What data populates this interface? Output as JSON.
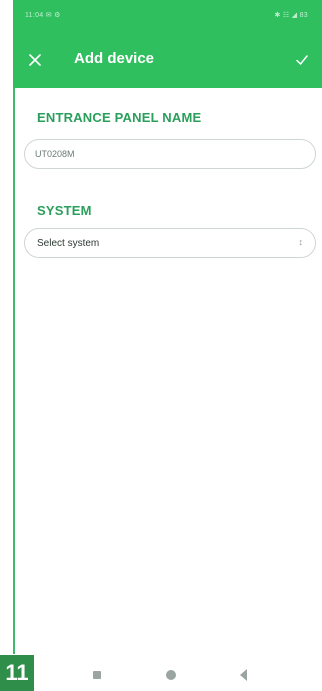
{
  "status_bar": {
    "left": "11:04 ✉ ⚙",
    "right": "✱ ☷ ◢ 83"
  },
  "header": {
    "title": "Add device",
    "close_icon": "close-icon",
    "confirm_icon": "check-icon"
  },
  "form": {
    "entrance_panel_label": "ENTRANCE PANEL NAME",
    "entrance_panel_value": "UT0208M",
    "system_label": "SYSTEM",
    "system_selected": "Select system",
    "system_arrow": "↕"
  },
  "footer": {
    "page_number": "11"
  },
  "colors": {
    "header_green": "#2fbf5f",
    "label_green": "#2a9f5b",
    "badge_green": "#2f8f4a"
  }
}
